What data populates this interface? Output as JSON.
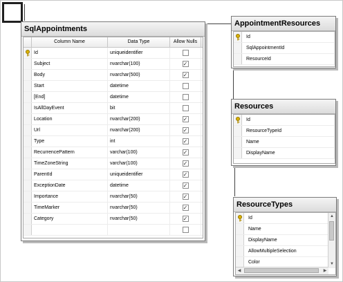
{
  "tables": {
    "sqlappointments": {
      "title": "SqlAppointments",
      "headers": [
        "Column Name",
        "Data Type",
        "Allow Nulls"
      ],
      "rows": [
        {
          "name": "Id",
          "type": "uniqueidentifier",
          "nulls": false,
          "key": true
        },
        {
          "name": "Subject",
          "type": "nvarchar(100)",
          "nulls": true
        },
        {
          "name": "Body",
          "type": "nvarchar(500)",
          "nulls": true
        },
        {
          "name": "Start",
          "type": "datetime",
          "nulls": false
        },
        {
          "name": "[End]",
          "type": "datetime",
          "nulls": false
        },
        {
          "name": "IsAllDayEvent",
          "type": "bit",
          "nulls": false
        },
        {
          "name": "Location",
          "type": "nvarchar(200)",
          "nulls": true
        },
        {
          "name": "Url",
          "type": "nvarchar(200)",
          "nulls": true
        },
        {
          "name": "Type",
          "type": "int",
          "nulls": true
        },
        {
          "name": "RecurrencePattern",
          "type": "varchar(100)",
          "nulls": true
        },
        {
          "name": "TimeZoneString",
          "type": "varchar(100)",
          "nulls": true
        },
        {
          "name": "ParentId",
          "type": "uniqueidentifier",
          "nulls": true
        },
        {
          "name": "ExceptionDate",
          "type": "datetime",
          "nulls": true
        },
        {
          "name": "Importance",
          "type": "nvarchar(50)",
          "nulls": true
        },
        {
          "name": "TimeMarker",
          "type": "nvarchar(50)",
          "nulls": true
        },
        {
          "name": "Category",
          "type": "nvarchar(50)",
          "nulls": true
        },
        {
          "name": "",
          "type": "",
          "nulls": false
        }
      ]
    },
    "appointmentresources": {
      "title": "AppointmentResources",
      "columns": [
        {
          "name": "Id",
          "key": true
        },
        {
          "name": "SqlAppointmentId",
          "key": false
        },
        {
          "name": "ResourceId",
          "key": false
        }
      ]
    },
    "resources": {
      "title": "Resources",
      "columns": [
        {
          "name": "Id",
          "key": true
        },
        {
          "name": "ResourceTypeId",
          "key": false
        },
        {
          "name": "Name",
          "key": false
        },
        {
          "name": "DisplayName",
          "key": false
        }
      ]
    },
    "resourcetypes": {
      "title": "ResourceTypes",
      "columns": [
        {
          "name": "Id",
          "key": true
        },
        {
          "name": "Name",
          "key": false
        },
        {
          "name": "DisplayName",
          "key": false
        },
        {
          "name": "AllowMultipleSelection",
          "key": false
        },
        {
          "name": "Color",
          "key": false
        }
      ]
    }
  },
  "icons": {
    "key": "key-icon",
    "checkbox": "checkbox-icon"
  },
  "colors": {
    "key": "#d8b000",
    "border": "#7a7a7a"
  }
}
